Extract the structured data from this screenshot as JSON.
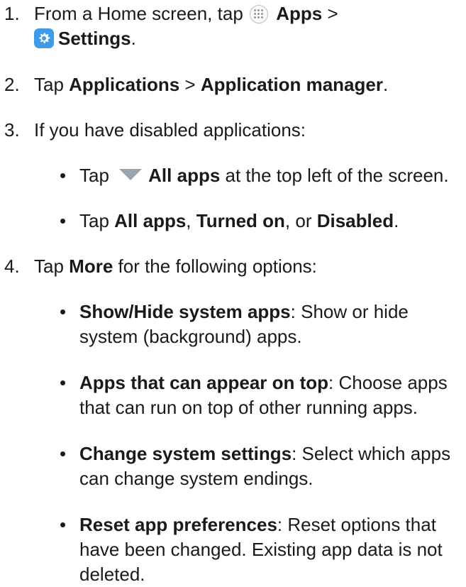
{
  "steps": [
    {
      "num": "1.",
      "t1": "From a Home screen, tap ",
      "b1": "Apps",
      "t2": " >",
      "b2": "Settings",
      "t3": "."
    },
    {
      "num": "2.",
      "t1": "Tap ",
      "b1": "Applications",
      "t2": " > ",
      "b2": "Application manager",
      "t3": "."
    },
    {
      "num": "3.",
      "t1": "If you have disabled applications:",
      "bullets": [
        {
          "t1": "Tap ",
          "b1": "All apps",
          "t2": " at the top left of the screen."
        },
        {
          "t1": "Tap ",
          "b1": "All apps",
          "t2": ", ",
          "b2": "Turned on",
          "t3": ", or ",
          "b3": "Disabled",
          "t4": "."
        }
      ]
    },
    {
      "num": "4.",
      "t1": "Tap ",
      "b1": "More",
      "t2": " for the following options:",
      "bullets": [
        {
          "b1": "Show/Hide system apps",
          "t1": ": Show or hide system (background) apps."
        },
        {
          "b1": "Apps that can appear on top",
          "t1": ": Choose apps that can run on top of other running apps."
        },
        {
          "b1": "Change system settings",
          "t1": ": Select which apps can change system endings."
        },
        {
          "b1": "Reset app preferences",
          "t1": ": Reset options that have been changed. Existing app data is not deleted."
        }
      ]
    }
  ],
  "bullet_glyph": "•",
  "icons": {
    "apps": "apps-grid-icon",
    "settings": "settings-gear-icon",
    "dropdown": "dropdown-triangle-icon"
  },
  "colors": {
    "text": "#1a1a1a",
    "settings_icon_bg": "#3d9be9",
    "dropdown_triangle": "#9aa6ad",
    "apps_icon_border": "#bdbdbd"
  }
}
